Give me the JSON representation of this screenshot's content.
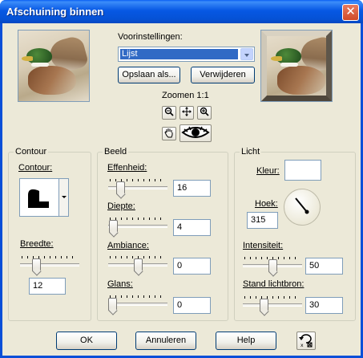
{
  "window": {
    "title": "Afschuining binnen",
    "close_symbol": "✕"
  },
  "presets": {
    "label": "Voorinstellingen:",
    "selected": "Lijst",
    "save_as": "Opslaan als...",
    "delete": "Verwijderen"
  },
  "zoom": {
    "label": "Zoomen 1:1",
    "level": "1:1"
  },
  "contour_group": {
    "title": "Contour",
    "contour_label": "Contour:",
    "width_label": "Breedte:",
    "width_value": "12",
    "width_slider_fraction": 0.24
  },
  "image_group": {
    "title": "Beeld",
    "smoothness_label": "Effenheid:",
    "smoothness_value": "16",
    "smoothness_slider_fraction": 0.16,
    "depth_label": "Diepte:",
    "depth_value": "4",
    "depth_slider_fraction": 0.02,
    "ambience_label": "Ambiance:",
    "ambience_value": "0",
    "ambience_slider_fraction": 0.5,
    "gloss_label": "Glans:",
    "gloss_value": "0",
    "gloss_slider_fraction": 0.0
  },
  "light_group": {
    "title": "Licht",
    "color_label": "Kleur:",
    "color_value": "#FFFFFF",
    "angle_label": "Hoek:",
    "angle_value": "315",
    "intensity_label": "Intensiteit:",
    "intensity_value": "50",
    "intensity_slider_fraction": 0.5,
    "elevation_label": "Stand lichtbron:",
    "elevation_value": "30",
    "elevation_slider_fraction": 0.33
  },
  "footer": {
    "ok": "OK",
    "cancel": "Annuleren",
    "help": "Help"
  },
  "icons": {
    "zoom_out": "zoom-out-icon",
    "pan": "pan-icon",
    "zoom_in": "zoom-in-icon",
    "hand": "hand-icon",
    "eye": "eye-icon",
    "reset": "reset-icon"
  },
  "colors": {
    "title_bar": "#0A5FF4",
    "dialog_bg": "#ECE9D8",
    "selection": "#316AC5"
  }
}
